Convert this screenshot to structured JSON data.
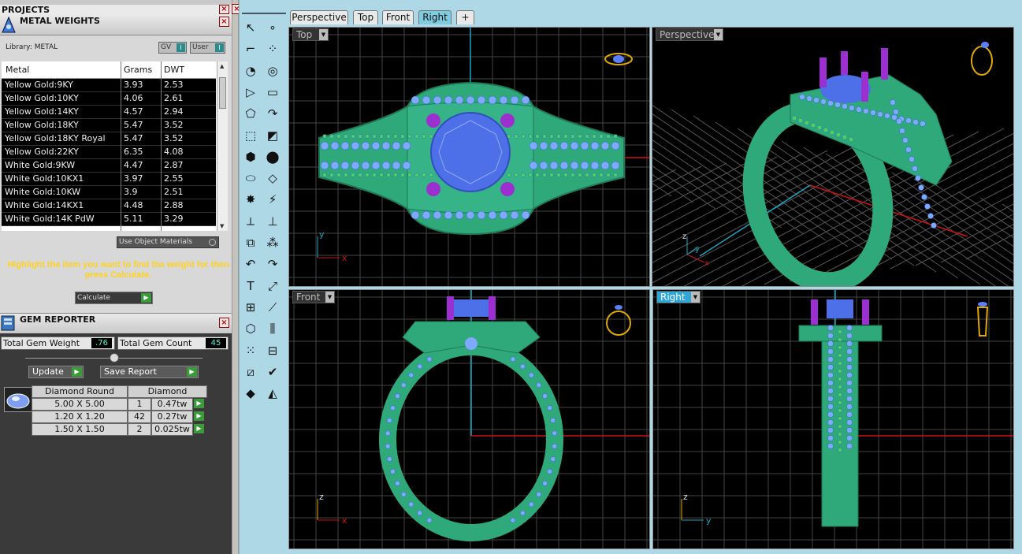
{
  "left_panel": {
    "projects_title": "PROJECTS",
    "metal_weights": {
      "title": "METAL WEIGHTS",
      "library_label": "Library: METAL",
      "toggle_gv": "GV",
      "toggle_user": "User",
      "columns": [
        "Metal",
        "Grams",
        "DWT"
      ],
      "rows": [
        [
          "Yellow Gold:9KY",
          "3.93",
          "2.53"
        ],
        [
          "Yellow Gold:10KY",
          "4.06",
          "2.61"
        ],
        [
          "Yellow Gold:14KY",
          "4.57",
          "2.94"
        ],
        [
          "Yellow Gold:18KY",
          "5.47",
          "3.52"
        ],
        [
          "Yellow Gold:18KY Royal",
          "5.47",
          "3.52"
        ],
        [
          "Yellow Gold:22KY",
          "6.35",
          "4.08"
        ],
        [
          "White Gold:9KW",
          "4.47",
          "2.87"
        ],
        [
          "White Gold:10KX1",
          "3.97",
          "2.55"
        ],
        [
          "White Gold:10KW",
          "3.9",
          "2.51"
        ],
        [
          "White Gold:14KX1",
          "4.48",
          "2.88"
        ],
        [
          "White Gold:14K PdW",
          "5.11",
          "3.29"
        ]
      ],
      "use_object_materials": "Use Object Materials",
      "hint": "Highlight the item you want to find the weight for then press Calculate.",
      "calculate": "Calculate"
    },
    "gem_reporter": {
      "title": "GEM REPORTER",
      "total_weight_label": "Total Gem Weight",
      "total_weight_value": ".76",
      "total_count_label": "Total Gem Count",
      "total_count_value": "45",
      "update": "Update",
      "save_report": "Save Report",
      "shape_header": "Diamond Round",
      "material_header": "Diamond",
      "rows": [
        [
          "5.00 X 5.00",
          "1",
          "0.47tw"
        ],
        [
          "1.20 X 1.20",
          "42",
          "0.27tw"
        ],
        [
          "1.50 X 1.50",
          "2",
          "0.025tw"
        ]
      ]
    }
  },
  "viewport_tabs": [
    "Perspective",
    "Top",
    "Front",
    "Right",
    "+"
  ],
  "active_tab": "Right",
  "viewports": {
    "top": "Top",
    "perspective": "Perspective",
    "front": "Front",
    "right": "Right"
  },
  "axis_labels": {
    "x": "x",
    "y": "y",
    "z": "z"
  },
  "colors": {
    "ring_green": "#2fa87a",
    "gem_blue": "#5b7fff",
    "prong_purple": "#9b2fd0",
    "axis_red": "#d01010",
    "axis_cyan": "#1aa6c0",
    "toolbar_bg": "#aed8e6"
  }
}
